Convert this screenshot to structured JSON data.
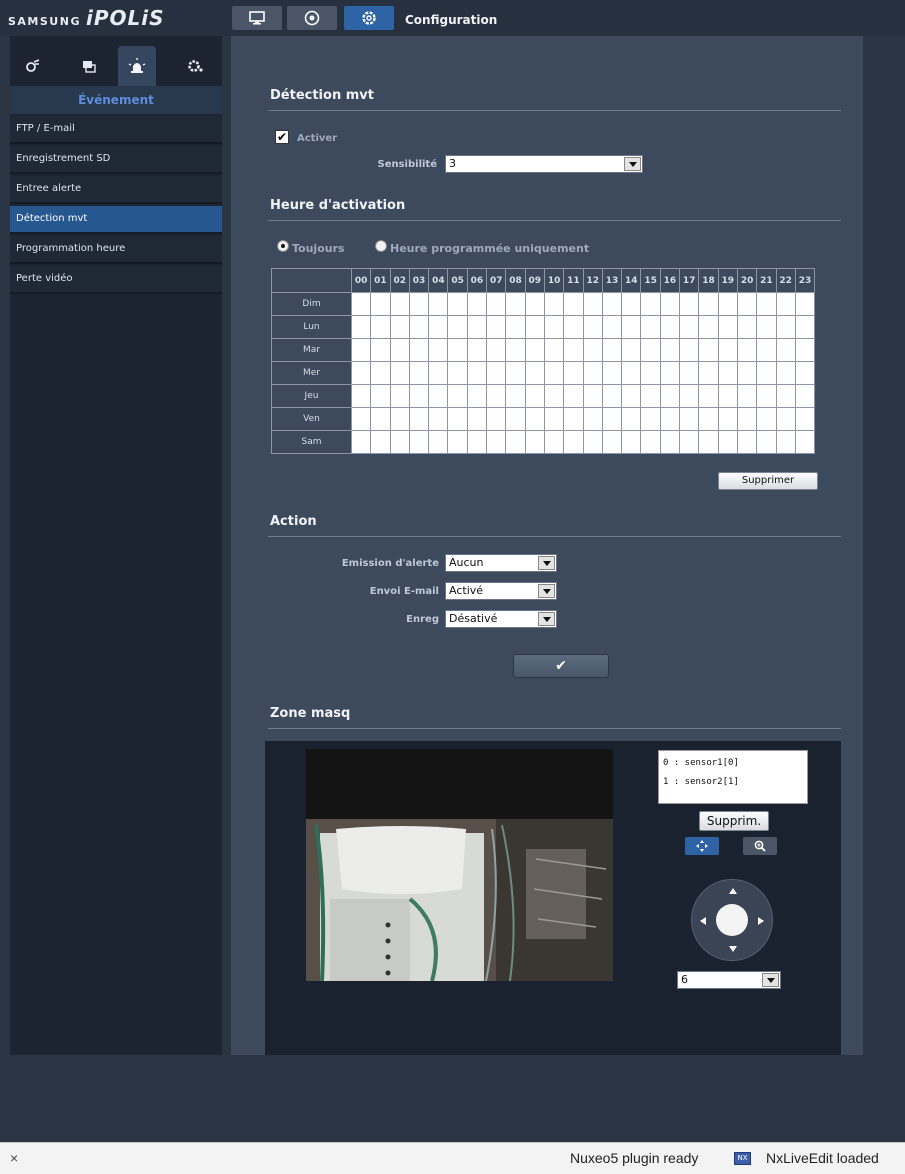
{
  "header": {
    "brand": "SAMSUNG",
    "product": "iPOLiS",
    "title": "Configuration",
    "icons": [
      "monitor-icon",
      "playback-icon",
      "setup-icon"
    ]
  },
  "sidebar": {
    "tab_icons": [
      "video-audio-icon",
      "network-icon",
      "event-icon",
      "system-icon"
    ],
    "title": "Événement",
    "items": [
      {
        "label": "FTP / E-mail",
        "active": false
      },
      {
        "label": "Enregistrement SD",
        "active": false
      },
      {
        "label": "Entree alerte",
        "active": false
      },
      {
        "label": "Détection mvt",
        "active": true
      },
      {
        "label": "Programmation heure",
        "active": false
      },
      {
        "label": "Perte vidéo",
        "active": false
      }
    ]
  },
  "motion": {
    "title": "Détection mvt",
    "enable_label": "Activer",
    "enable_checked": true,
    "sensitivity_label": "Sensibilité",
    "sensitivity_value": "3"
  },
  "activation": {
    "title": "Heure d'activation",
    "always_label": "Toujours",
    "scheduled_label": "Heure programmée uniquement",
    "selected": "Toujours",
    "hours": [
      "00",
      "01",
      "02",
      "03",
      "04",
      "05",
      "06",
      "07",
      "08",
      "09",
      "10",
      "11",
      "12",
      "13",
      "14",
      "15",
      "16",
      "17",
      "18",
      "19",
      "20",
      "21",
      "22",
      "23"
    ],
    "days": [
      "Dim",
      "Lun",
      "Mar",
      "Mer",
      "Jeu",
      "Ven",
      "Sam"
    ],
    "delete_label": "Supprimer"
  },
  "action": {
    "title": "Action",
    "alarm_label": "Emission d'alerte",
    "alarm_value": "Aucun",
    "email_label": "Envoi E-mail",
    "email_value": "Activé",
    "record_label": "Enreg",
    "record_value": "Désativé",
    "apply_symbol": "✔"
  },
  "mask": {
    "title": "Zone masq",
    "zones": [
      "0 : sensor1[0]",
      "1 : sensor2[1]"
    ],
    "delete_label": "Supprim.",
    "speed_value": "6"
  },
  "statusbar": {
    "close_symbol": "×",
    "plugin_text": "Nuxeo5 plugin ready",
    "nx_icon_text": "NX",
    "liveedit_text": "NxLiveEdit loaded"
  },
  "colors": {
    "accent": "#2e64a6",
    "active_menu": "#26578e",
    "panel": "#3d4a5d"
  }
}
